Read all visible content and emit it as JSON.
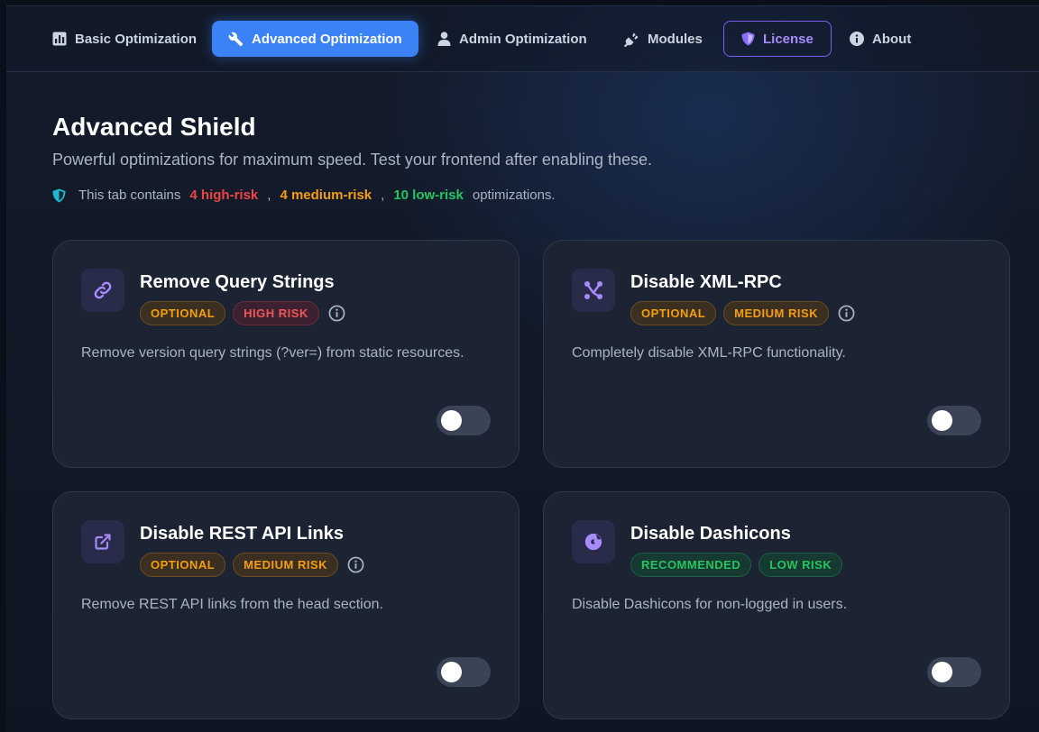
{
  "nav": {
    "tabs": [
      {
        "label": "Basic Optimization",
        "icon": "chart-square-icon"
      },
      {
        "label": "Advanced Optimization",
        "icon": "wrench-icon",
        "active": true
      },
      {
        "label": "Admin Optimization",
        "icon": "user-icon"
      },
      {
        "label": "Modules",
        "icon": "plug-icon"
      },
      {
        "label": "License",
        "icon": "shield-icon"
      },
      {
        "label": "About",
        "icon": "info-icon"
      }
    ]
  },
  "header": {
    "title": "Advanced Shield",
    "subtitle": "Powerful optimizations for maximum speed. Test your frontend after enabling these.",
    "summary": {
      "prefix": "This tab contains",
      "high": "4 high-risk",
      "sep1": ",",
      "medium": "4 medium-risk",
      "sep2": ",",
      "low": "10 low-risk",
      "suffix": "optimizations."
    }
  },
  "cards": [
    {
      "title": "Remove Query Strings",
      "icon": "link-icon",
      "badges": [
        "OPTIONAL",
        "HIGH RISK"
      ],
      "info": true,
      "description": "Remove version query strings (?ver=) from static resources.",
      "enabled": false
    },
    {
      "title": "Disable XML-RPC",
      "icon": "nodes-icon",
      "badges": [
        "OPTIONAL",
        "MEDIUM RISK"
      ],
      "info": true,
      "description": "Completely disable XML-RPC functionality.",
      "enabled": false
    },
    {
      "title": "Disable REST API Links",
      "icon": "external-link-icon",
      "badges": [
        "OPTIONAL",
        "MEDIUM RISK"
      ],
      "info": true,
      "description": "Remove REST API links from the head section.",
      "enabled": false
    },
    {
      "title": "Disable Dashicons",
      "icon": "dashicons-logo-icon",
      "badges": [
        "RECOMMENDED",
        "LOW RISK"
      ],
      "info": false,
      "description": "Disable Dashicons for non-logged in users.",
      "enabled": false
    }
  ],
  "colors": {
    "accent": "#3b82f6",
    "license": "#a78bfa",
    "high_risk": "#ef4444",
    "medium_risk": "#f59e0b",
    "low_risk": "#22c55e"
  }
}
